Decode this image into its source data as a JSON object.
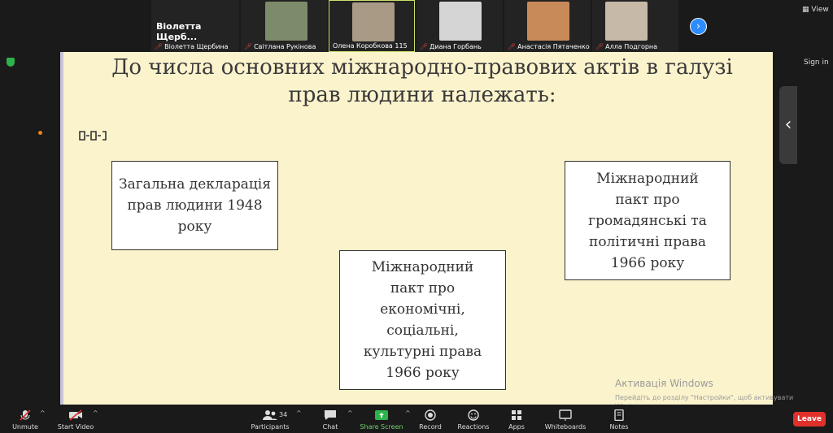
{
  "gallery": [
    {
      "name": "Віолетта Щербина",
      "big": "Віолетта  Щерб...",
      "photo": "#232323"
    },
    {
      "name": "Світлана Рукінова",
      "photo": "#7c8b6a"
    },
    {
      "name": "Олена Коробкова 115",
      "photo": "#a89a84"
    },
    {
      "name": "Диана Горбань",
      "photo": "#d5d5d5"
    },
    {
      "name": "Анастасія Пятаченко ...",
      "photo": "#c98a5a"
    },
    {
      "name": "Алла Подгорна",
      "photo": "#c6b9a8"
    }
  ],
  "top": {
    "view_label": "View",
    "signin_label": "Sign in"
  },
  "slide": {
    "title": "До числа основних міжнародно-правових актів в галузі прав людини належать:",
    "boxes": [
      "Загальна декларація прав людини 1948 року",
      "Міжнародний пакт про економічні, соціальні, культурні права 1966 року",
      "Міжнародний пакт про громадянські та політичні права 1966 року"
    ]
  },
  "watermark": {
    "title": "Активація Windows",
    "subtitle": "Перейдіть до розділу \"Настройки\", щоб активувати Windows."
  },
  "toolbar": {
    "unmute": "Unmute",
    "start_video": "Start Video",
    "participants": "Participants",
    "participants_count": "34",
    "chat": "Chat",
    "share_screen": "Share Screen",
    "record": "Record",
    "reactions": "Reactions",
    "apps": "Apps",
    "whiteboards": "Whiteboards",
    "notes": "Notes",
    "leave": "Leave"
  },
  "colors": {
    "share_green": "#2fb24c",
    "leave_red": "#e0302b",
    "accent_blue": "#2d8cff"
  }
}
